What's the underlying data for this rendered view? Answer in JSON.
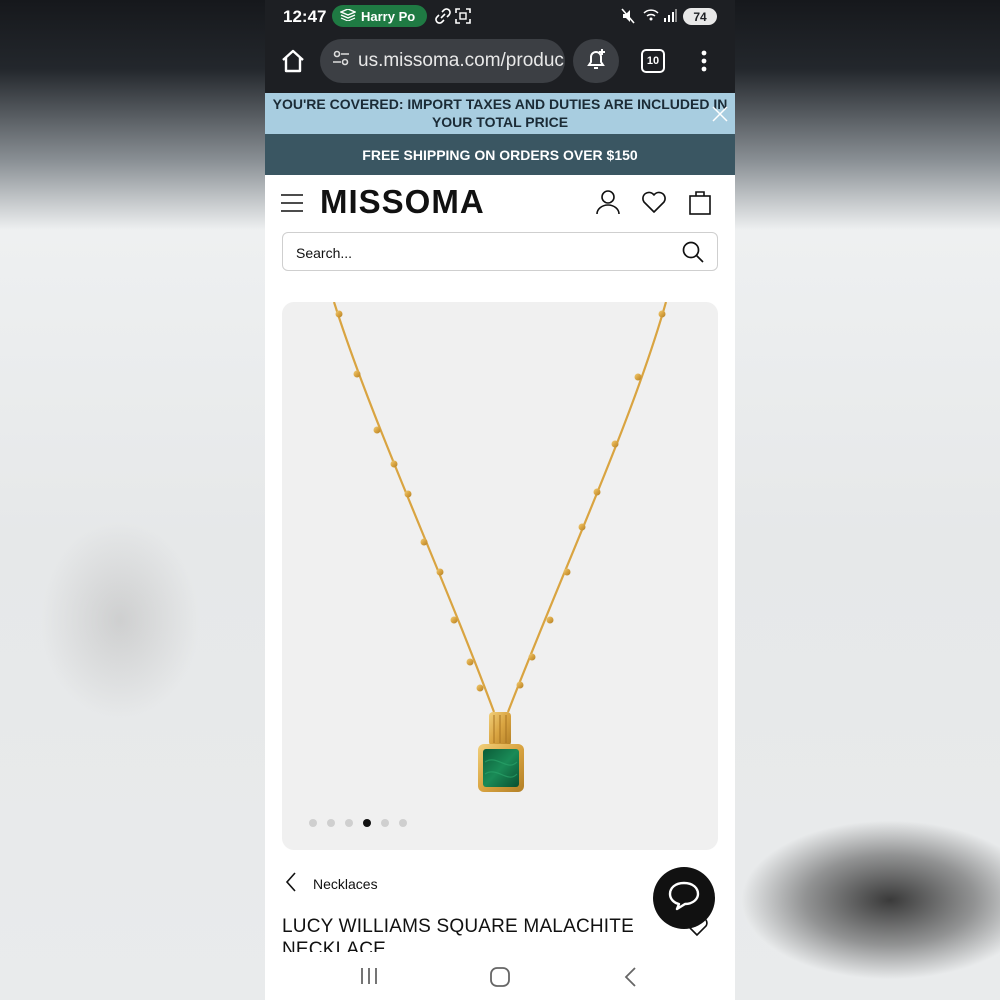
{
  "status_bar": {
    "time": "12:47",
    "media_label": "Harry Po",
    "battery": "74",
    "icons": [
      "audiobook-icon",
      "link-icon",
      "screenshot-icon",
      "mute-icon",
      "wifi-icon",
      "signal-icon",
      "battery-icon"
    ]
  },
  "browser": {
    "url": "us.missoma.com/produc",
    "tab_count": "10",
    "icons": [
      "home-icon",
      "site-settings-icon",
      "add-notification-icon",
      "tabs-icon",
      "more-menu-icon"
    ]
  },
  "banners": {
    "import_notice": "YOU'RE COVERED: IMPORT TAXES AND DUTIES ARE INCLUDED IN YOUR TOTAL PRICE",
    "shipping": "FREE SHIPPING ON ORDERS OVER $150"
  },
  "header": {
    "logo": "MISSOMA",
    "icons": [
      "hamburger-menu-icon",
      "account-icon",
      "heart-icon",
      "bag-icon"
    ]
  },
  "search": {
    "placeholder": "Search..."
  },
  "gallery": {
    "total_images": 6,
    "active_index": 3
  },
  "breadcrumb": {
    "label": "Necklaces"
  },
  "product": {
    "title": "LUCY WILLIAMS SQUARE MALACHITE NECKLACE"
  },
  "colors": {
    "status_bg": "#1d1f23",
    "media_pill": "#1f7a43",
    "banner_blue": "#a8cde0",
    "banner_dark": "#3a5662",
    "gold": "#d9a441",
    "malachite": "#12744a"
  },
  "nav_bar": {
    "icons": [
      "recents-icon",
      "home-circle-icon",
      "back-icon"
    ]
  }
}
